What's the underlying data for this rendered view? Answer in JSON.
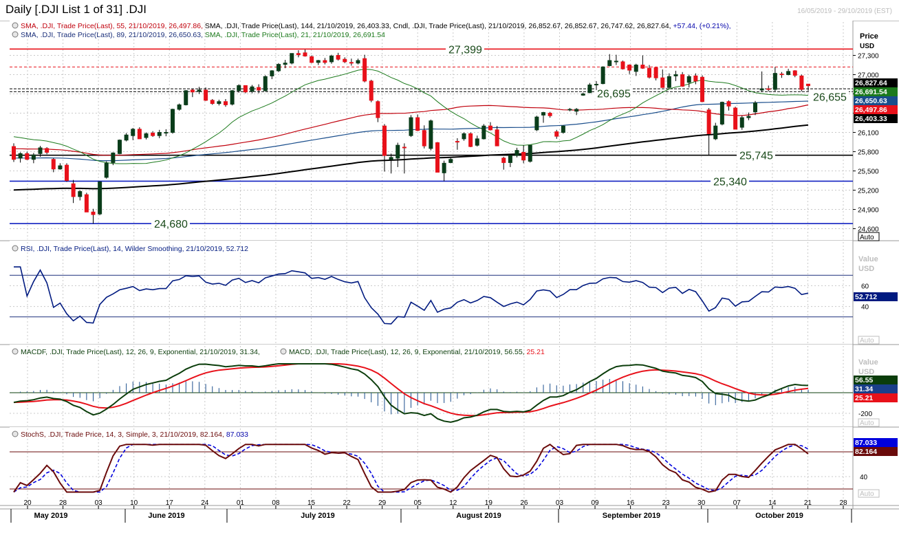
{
  "title": "Daily [.DJI List 1 of 31] .DJI",
  "date_range": "16/05/2019 - 29/10/2019 (EST)",
  "colors": {
    "red": "#e8111a",
    "darkred": "#8a1a12",
    "green": "#1c7a1c",
    "darkgreen": "#0b3d0b",
    "blue": "#1a2f7a",
    "navy": "#000a7a",
    "black": "#000000",
    "rsiblue": "#001a80"
  },
  "price_panel": {
    "legend1": [
      {
        "text": "SMA, .DJI, Trade Price(Last),   55, 21/10/2019, 26,497.86,",
        "color": "#c0000c"
      },
      {
        "text": "SMA, .DJI, Trade Price(Last),   144, 21/10/2019, 26,403.33,",
        "color": "#000000"
      },
      {
        "text": "Cndl, .DJI, Trade Price(Last), 21/10/2019, 26,852.67, 26,852.67, 26,747.62, 26,827.64,",
        "color": "#000000"
      },
      {
        "text": "+57.44, (+0.21%),",
        "color": "#0000aa"
      }
    ],
    "legend2": [
      {
        "text": "SMA, .DJI, Trade Price(Last),   89, 21/10/2019, 26,650.63,",
        "color": "#1a2f7a"
      },
      {
        "text": "SMA, .DJI, Trade Price(Last),   21, 21/10/2019, 26,691.54",
        "color": "#1c7a1c"
      }
    ],
    "axis_title": "Price",
    "axis_unit": "USD",
    "auto_label": "Auto",
    "ticks": [
      "27,300",
      "27,000",
      "26,700",
      "26,400",
      "26,100",
      "25,800",
      "25,500",
      "25,200",
      "24,900",
      "24,600"
    ],
    "level_labels": {
      "l27399": "27,399",
      "l26695": "26,695",
      "l26655": "26,655",
      "l25745": "25,745",
      "l25340": "25,340",
      "l24680": "24,680"
    },
    "badges": [
      {
        "text": "26,827.64",
        "bg": "#000000",
        "fg": "#ffffff"
      },
      {
        "text": "26,691.54",
        "bg": "#1c7a1c",
        "fg": "#ffffff"
      },
      {
        "text": "26,650.63",
        "bg": "#1a4e8c",
        "fg": "#ffffff"
      },
      {
        "text": "26,497.86",
        "bg": "#e8111a",
        "fg": "#ffffff"
      },
      {
        "text": "26,403.33",
        "bg": "#000000",
        "fg": "#ffffff"
      }
    ]
  },
  "rsi_panel": {
    "legend": "RSI, .DJI, Trade Price(Last),   14, Wilder Smoothing, 21/10/2019, 52.712",
    "axis_title": "Value",
    "axis_unit": "USD",
    "ticks": [
      "60",
      "40"
    ],
    "badge": "52.712",
    "auto_label": "Auto"
  },
  "macd_panel": {
    "legend1": "MACDF, .DJI, Trade Price(Last),   12, 26, 9, Exponential, 21/10/2019, 31.34,",
    "legend2a": "MACD, .DJI, Trade Price(Last),   12, 26, 9, Exponential, 21/10/2019, 56.55,",
    "legend2b": "25.21",
    "axis_title": "Value",
    "axis_unit": "USD",
    "ticks": [
      "-200"
    ],
    "badges": [
      {
        "text": "56.55",
        "bg": "#0b3d0b",
        "fg": "#ffffff"
      },
      {
        "text": "31.34",
        "bg": "#1a3f8a",
        "fg": "#ffffff"
      },
      {
        "text": "25.21",
        "bg": "#e8111a",
        "fg": "#ffffff"
      }
    ],
    "auto_label": "Auto"
  },
  "stoch_panel": {
    "legend1": "StochS, .DJI, Trade Price,   14, 3, Simple, 3, 21/10/2019, 82.164,",
    "legend2": "87.033",
    "ticks": [
      "40"
    ],
    "badges": [
      {
        "text": "87.033",
        "bg": "#0000dd",
        "fg": "#ffffff"
      },
      {
        "text": "82.164",
        "bg": "#6a0a0a",
        "fg": "#ffffff"
      }
    ],
    "auto_label": "Auto"
  },
  "x_axis": {
    "days": [
      "20",
      "28",
      "03",
      "10",
      "17",
      "24",
      "01",
      "08",
      "15",
      "22",
      "29",
      "05",
      "12",
      "19",
      "26",
      "03",
      "09",
      "16",
      "23",
      "30",
      "07",
      "14",
      "21",
      "28"
    ],
    "months": [
      "May 2019",
      "June 2019",
      "July 2019",
      "August 2019",
      "September 2019",
      "October 2019"
    ]
  },
  "chart_data": {
    "type": "candlestick",
    "instrument": ".DJI",
    "candles": [
      {
        "o": 25880,
        "h": 25930,
        "l": 25640,
        "c": 25680
      },
      {
        "o": 25700,
        "h": 25790,
        "l": 25630,
        "c": 25770
      },
      {
        "o": 25770,
        "h": 25800,
        "l": 25670,
        "c": 25680
      },
      {
        "o": 25680,
        "h": 25780,
        "l": 25620,
        "c": 25750
      },
      {
        "o": 25770,
        "h": 25890,
        "l": 25720,
        "c": 25860
      },
      {
        "o": 25850,
        "h": 25870,
        "l": 25760,
        "c": 25790
      },
      {
        "o": 25680,
        "h": 25700,
        "l": 25480,
        "c": 25530
      },
      {
        "o": 25530,
        "h": 25620,
        "l": 25520,
        "c": 25580
      },
      {
        "o": 25590,
        "h": 25620,
        "l": 25330,
        "c": 25350
      },
      {
        "o": 25300,
        "h": 25360,
        "l": 25000,
        "c": 25100
      },
      {
        "o": 25100,
        "h": 25200,
        "l": 25040,
        "c": 25180
      },
      {
        "o": 25130,
        "h": 25160,
        "l": 24960,
        "c": 24860
      },
      {
        "o": 24860,
        "h": 24910,
        "l": 24680,
        "c": 24820
      },
      {
        "o": 24830,
        "h": 25340,
        "l": 24810,
        "c": 25330
      },
      {
        "o": 25400,
        "h": 25650,
        "l": 25380,
        "c": 25620
      },
      {
        "o": 25630,
        "h": 25790,
        "l": 25590,
        "c": 25780
      },
      {
        "o": 25770,
        "h": 25990,
        "l": 25760,
        "c": 25980
      },
      {
        "o": 25980,
        "h": 26090,
        "l": 25960,
        "c": 26060
      },
      {
        "o": 26050,
        "h": 26170,
        "l": 25980,
        "c": 26150
      },
      {
        "o": 26150,
        "h": 26180,
        "l": 26000,
        "c": 26000
      },
      {
        "o": 26020,
        "h": 26100,
        "l": 25990,
        "c": 26080
      },
      {
        "o": 26090,
        "h": 26120,
        "l": 26030,
        "c": 26050
      },
      {
        "o": 26050,
        "h": 26140,
        "l": 26010,
        "c": 26100
      },
      {
        "o": 26100,
        "h": 26150,
        "l": 26040,
        "c": 26100
      },
      {
        "o": 26100,
        "h": 26470,
        "l": 26080,
        "c": 26460
      },
      {
        "o": 26460,
        "h": 26550,
        "l": 26440,
        "c": 26530
      },
      {
        "o": 26530,
        "h": 26760,
        "l": 26520,
        "c": 26750
      },
      {
        "o": 26760,
        "h": 26780,
        "l": 26650,
        "c": 26730
      },
      {
        "o": 26740,
        "h": 26810,
        "l": 26700,
        "c": 26760
      },
      {
        "o": 26760,
        "h": 26800,
        "l": 26590,
        "c": 26600
      },
      {
        "o": 26600,
        "h": 26620,
        "l": 26530,
        "c": 26550
      },
      {
        "o": 26550,
        "h": 26610,
        "l": 26520,
        "c": 26580
      },
      {
        "o": 26580,
        "h": 26620,
        "l": 26500,
        "c": 26530
      },
      {
        "o": 26540,
        "h": 26760,
        "l": 26520,
        "c": 26750
      },
      {
        "o": 26750,
        "h": 26850,
        "l": 26720,
        "c": 26830
      },
      {
        "o": 26830,
        "h": 26830,
        "l": 26710,
        "c": 26730
      },
      {
        "o": 26740,
        "h": 26840,
        "l": 26710,
        "c": 26810
      },
      {
        "o": 26800,
        "h": 26850,
        "l": 26710,
        "c": 26760
      },
      {
        "o": 26750,
        "h": 26990,
        "l": 26740,
        "c": 26970
      },
      {
        "o": 26980,
        "h": 27070,
        "l": 26930,
        "c": 27060
      },
      {
        "o": 27060,
        "h": 27180,
        "l": 27040,
        "c": 27160
      },
      {
        "o": 27160,
        "h": 27230,
        "l": 27100,
        "c": 27180
      },
      {
        "o": 27180,
        "h": 27330,
        "l": 27160,
        "c": 27330
      },
      {
        "o": 27330,
        "h": 27380,
        "l": 27270,
        "c": 27310
      },
      {
        "o": 27340,
        "h": 27390,
        "l": 27280,
        "c": 27290
      },
      {
        "o": 27280,
        "h": 27300,
        "l": 27180,
        "c": 27190
      },
      {
        "o": 27190,
        "h": 27230,
        "l": 27150,
        "c": 27220
      },
      {
        "o": 27220,
        "h": 27260,
        "l": 27160,
        "c": 27190
      },
      {
        "o": 27200,
        "h": 27310,
        "l": 27170,
        "c": 27290
      },
      {
        "o": 27300,
        "h": 27340,
        "l": 27220,
        "c": 27240
      },
      {
        "o": 27240,
        "h": 27270,
        "l": 27180,
        "c": 27200
      },
      {
        "o": 27190,
        "h": 27250,
        "l": 27140,
        "c": 27180
      },
      {
        "o": 27180,
        "h": 27250,
        "l": 27160,
        "c": 27220
      },
      {
        "o": 27250,
        "h": 27310,
        "l": 26880,
        "c": 26900
      },
      {
        "o": 26900,
        "h": 26920,
        "l": 26570,
        "c": 26600
      },
      {
        "o": 26580,
        "h": 26600,
        "l": 26260,
        "c": 26330
      },
      {
        "o": 26200,
        "h": 26230,
        "l": 25490,
        "c": 25740
      },
      {
        "o": 25680,
        "h": 25770,
        "l": 25460,
        "c": 25710
      },
      {
        "o": 25700,
        "h": 25940,
        "l": 25560,
        "c": 25900
      },
      {
        "o": 25870,
        "h": 25930,
        "l": 25460,
        "c": 25860
      },
      {
        "o": 26050,
        "h": 26370,
        "l": 26030,
        "c": 26330
      },
      {
        "o": 26330,
        "h": 26380,
        "l": 26120,
        "c": 26130
      },
      {
        "o": 26130,
        "h": 26210,
        "l": 25850,
        "c": 25890
      },
      {
        "o": 25850,
        "h": 26300,
        "l": 25820,
        "c": 26280
      },
      {
        "o": 25940,
        "h": 25950,
        "l": 25500,
        "c": 25480
      },
      {
        "o": 25470,
        "h": 25660,
        "l": 25340,
        "c": 25620
      },
      {
        "o": 25630,
        "h": 25700,
        "l": 25620,
        "c": 25680
      },
      {
        "o": 25960,
        "h": 26010,
        "l": 25830,
        "c": 25950
      },
      {
        "o": 26000,
        "h": 26100,
        "l": 25970,
        "c": 26080
      },
      {
        "o": 26080,
        "h": 26100,
        "l": 25870,
        "c": 25880
      },
      {
        "o": 25900,
        "h": 26050,
        "l": 25880,
        "c": 26000
      },
      {
        "o": 26000,
        "h": 26230,
        "l": 25990,
        "c": 26200
      },
      {
        "o": 26200,
        "h": 26260,
        "l": 26130,
        "c": 26140
      },
      {
        "o": 26140,
        "h": 26200,
        "l": 25900,
        "c": 25890
      },
      {
        "o": 25700,
        "h": 25720,
        "l": 25520,
        "c": 25630
      },
      {
        "o": 25630,
        "h": 25760,
        "l": 25560,
        "c": 25740
      },
      {
        "o": 25740,
        "h": 25860,
        "l": 25710,
        "c": 25820
      },
      {
        "o": 25790,
        "h": 25900,
        "l": 25620,
        "c": 25670
      },
      {
        "o": 25650,
        "h": 25900,
        "l": 25630,
        "c": 25900
      },
      {
        "o": 26140,
        "h": 26360,
        "l": 26120,
        "c": 26340
      },
      {
        "o": 26370,
        "h": 26420,
        "l": 26250,
        "c": 26410
      },
      {
        "o": 26400,
        "h": 26420,
        "l": 26330,
        "c": 26360
      },
      {
        "o": 26110,
        "h": 26140,
        "l": 26000,
        "c": 26040
      },
      {
        "o": 26100,
        "h": 26210,
        "l": 26080,
        "c": 26200
      },
      {
        "o": 26450,
        "h": 26480,
        "l": 26430,
        "c": 26460
      },
      {
        "o": 26430,
        "h": 26480,
        "l": 26370,
        "c": 26460
      },
      {
        "o": 26680,
        "h": 26720,
        "l": 26670,
        "c": 26700
      },
      {
        "o": 26720,
        "h": 26870,
        "l": 26710,
        "c": 26840
      },
      {
        "o": 26840,
        "h": 26900,
        "l": 26760,
        "c": 26850
      },
      {
        "o": 26860,
        "h": 27130,
        "l": 26850,
        "c": 27120
      },
      {
        "o": 27140,
        "h": 27320,
        "l": 27130,
        "c": 27220
      },
      {
        "o": 27200,
        "h": 27310,
        "l": 27150,
        "c": 27210
      },
      {
        "o": 27200,
        "h": 27220,
        "l": 27080,
        "c": 27090
      },
      {
        "o": 27150,
        "h": 27160,
        "l": 27010,
        "c": 27070
      },
      {
        "o": 27050,
        "h": 27170,
        "l": 26980,
        "c": 27150
      },
      {
        "o": 27150,
        "h": 27300,
        "l": 27090,
        "c": 27100
      },
      {
        "o": 27100,
        "h": 27150,
        "l": 26940,
        "c": 26960
      },
      {
        "o": 27110,
        "h": 27110,
        "l": 26910,
        "c": 26950
      },
      {
        "o": 26950,
        "h": 27080,
        "l": 26890,
        "c": 26800
      },
      {
        "o": 26800,
        "h": 27020,
        "l": 26780,
        "c": 26970
      },
      {
        "o": 26980,
        "h": 27060,
        "l": 26900,
        "c": 27000
      },
      {
        "o": 27000,
        "h": 27040,
        "l": 26810,
        "c": 26820
      },
      {
        "o": 26880,
        "h": 27000,
        "l": 26800,
        "c": 26970
      },
      {
        "o": 26980,
        "h": 27020,
        "l": 26850,
        "c": 26900
      },
      {
        "o": 26960,
        "h": 26990,
        "l": 26570,
        "c": 26580
      },
      {
        "o": 26450,
        "h": 26480,
        "l": 25750,
        "c": 26080
      },
      {
        "o": 26000,
        "h": 26250,
        "l": 25980,
        "c": 26200
      },
      {
        "o": 26230,
        "h": 26580,
        "l": 26210,
        "c": 26570
      },
      {
        "o": 26580,
        "h": 26600,
        "l": 26440,
        "c": 26510
      },
      {
        "o": 26480,
        "h": 26500,
        "l": 26300,
        "c": 26150
      },
      {
        "o": 26180,
        "h": 26360,
        "l": 26140,
        "c": 26330
      },
      {
        "o": 26330,
        "h": 26410,
        "l": 26290,
        "c": 26350
      },
      {
        "o": 26420,
        "h": 26590,
        "l": 26370,
        "c": 26560
      },
      {
        "o": 26760,
        "h": 27050,
        "l": 26740,
        "c": 26780
      },
      {
        "o": 26780,
        "h": 26830,
        "l": 26740,
        "c": 26770
      },
      {
        "o": 26770,
        "h": 27120,
        "l": 26740,
        "c": 27020
      },
      {
        "o": 27010,
        "h": 27040,
        "l": 26950,
        "c": 27000
      },
      {
        "o": 27000,
        "h": 27090,
        "l": 26990,
        "c": 27050
      },
      {
        "o": 27060,
        "h": 27070,
        "l": 26960,
        "c": 26990
      },
      {
        "o": 26980,
        "h": 27000,
        "l": 26740,
        "c": 26770
      },
      {
        "o": 26852.67,
        "h": 26852.67,
        "l": 26747.62,
        "c": 26827.64
      }
    ],
    "sma21": {
      "name": "SMA 21",
      "last": 26691.54
    },
    "sma55": {
      "name": "SMA 55",
      "last": 26497.86
    },
    "sma89": {
      "name": "SMA 89",
      "last": 26650.63
    },
    "sma144": {
      "name": "SMA 144",
      "last": 26403.33
    },
    "levels": [
      27399,
      26695,
      26655,
      25745,
      25340,
      24680
    ],
    "y_range": [
      24520,
      27520
    ],
    "rsi": {
      "last": 52.712,
      "bands": [
        70,
        30
      ]
    },
    "macd": {
      "macd_last": 56.55,
      "signal_last": 25.21,
      "hist_last": 31.34
    },
    "stoch": {
      "k_last": 82.164,
      "d_last": 87.033,
      "bands": [
        80,
        20
      ]
    }
  }
}
